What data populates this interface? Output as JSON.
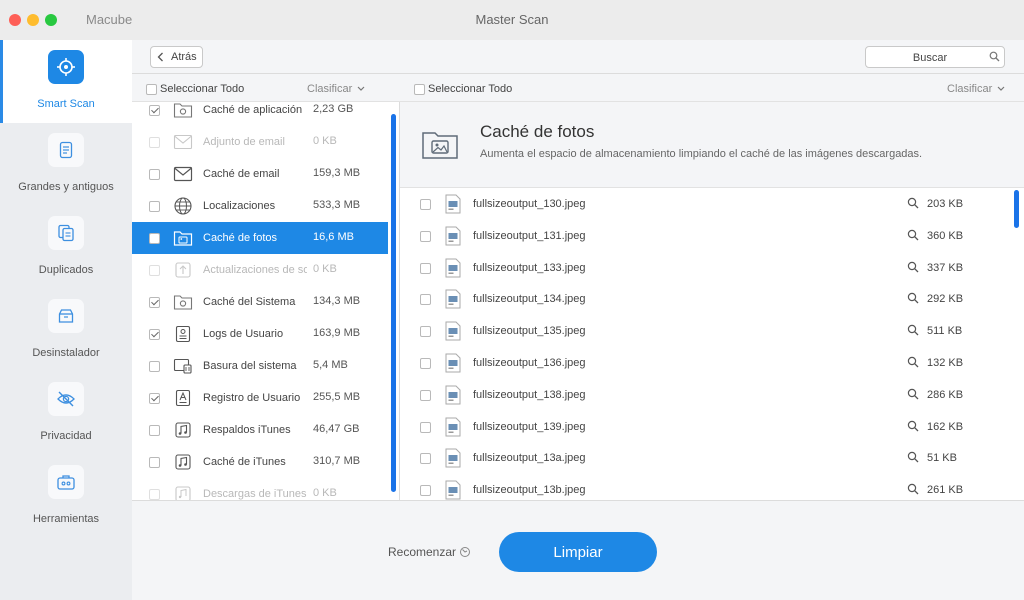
{
  "window": {
    "app_name": "Macube",
    "title": "Master Scan"
  },
  "sidebar": {
    "items": [
      {
        "label": "Smart Scan",
        "icon": "target-icon",
        "active": true
      },
      {
        "label": "Grandes y antiguos",
        "icon": "document-icon",
        "active": false
      },
      {
        "label": "Duplicados",
        "icon": "duplicate-icon",
        "active": false
      },
      {
        "label": "Desinstalador",
        "icon": "box-icon",
        "active": false
      },
      {
        "label": "Privacidad",
        "icon": "eye-off-icon",
        "active": false
      },
      {
        "label": "Herramientas",
        "icon": "toolbox-icon",
        "active": false
      }
    ]
  },
  "toolbar": {
    "back_label": "Atrás",
    "search_placeholder": "Buscar"
  },
  "left_panel": {
    "select_all": "Seleccionar Todo",
    "sort": "Clasificar",
    "categories": [
      {
        "name": "Caché de aplicación",
        "size": "2,23 GB",
        "checked": true,
        "dim": false,
        "icon": "gear-folder-icon"
      },
      {
        "name": "Adjunto de email",
        "size": "0 KB",
        "checked": false,
        "dim": true,
        "icon": "mail-attachment-icon"
      },
      {
        "name": "Caché de email",
        "size": "159,3 MB",
        "checked": false,
        "dim": false,
        "icon": "envelope-icon"
      },
      {
        "name": "Localizaciones",
        "size": "533,3 MB",
        "checked": false,
        "dim": false,
        "icon": "globe-icon"
      },
      {
        "name": "Caché de fotos",
        "size": "16,6 MB",
        "checked": false,
        "dim": false,
        "icon": "photo-folder-icon",
        "selected": true
      },
      {
        "name": "Actualizaciones de so",
        "size": "0 KB",
        "checked": false,
        "dim": true,
        "icon": "update-arrow-icon"
      },
      {
        "name": "Caché del Sistema",
        "size": "134,3 MB",
        "checked": true,
        "dim": false,
        "icon": "gear-folder-icon"
      },
      {
        "name": "Logs de Usuario",
        "size": "163,9 MB",
        "checked": true,
        "dim": false,
        "icon": "user-log-icon"
      },
      {
        "name": "Basura del sistema",
        "size": "5,4 MB",
        "checked": false,
        "dim": false,
        "icon": "system-trash-icon"
      },
      {
        "name": "Registro de Usuario",
        "size": "255,5 MB",
        "checked": true,
        "dim": false,
        "icon": "user-record-icon"
      },
      {
        "name": "Respaldos iTunes",
        "size": "46,47 GB",
        "checked": false,
        "dim": false,
        "icon": "music-note-icon"
      },
      {
        "name": "Caché de iTunes",
        "size": "310,7 MB",
        "checked": false,
        "dim": false,
        "icon": "music-note-icon"
      },
      {
        "name": "Descargas de iTunes",
        "size": "0 KB",
        "checked": false,
        "dim": true,
        "icon": "music-download-icon"
      }
    ]
  },
  "right_panel": {
    "select_all": "Seleccionar Todo",
    "sort": "Clasificar",
    "title": "Caché de fotos",
    "description": "Aumenta el espacio de almacenamiento limpiando el caché de las imágenes descargadas.",
    "files": [
      {
        "name": "fullsizeoutput_130.jpeg",
        "size": "203 KB"
      },
      {
        "name": "fullsizeoutput_131.jpeg",
        "size": "360 KB"
      },
      {
        "name": "fullsizeoutput_133.jpeg",
        "size": "337 KB"
      },
      {
        "name": "fullsizeoutput_134.jpeg",
        "size": "292 KB"
      },
      {
        "name": "fullsizeoutput_135.jpeg",
        "size": "511 KB"
      },
      {
        "name": "fullsizeoutput_136.jpeg",
        "size": "132 KB"
      },
      {
        "name": "fullsizeoutput_138.jpeg",
        "size": "286 KB"
      },
      {
        "name": "fullsizeoutput_139.jpeg",
        "size": "162 KB"
      },
      {
        "name": "fullsizeoutput_13a.jpeg",
        "size": "51 KB"
      },
      {
        "name": "fullsizeoutput_13b.jpeg",
        "size": "261 KB"
      }
    ]
  },
  "footer": {
    "restart_label": "Recomenzar",
    "clean_label": "Limpiar"
  },
  "colors": {
    "accent": "#1e88e5",
    "sidebar_bg": "#ebedf0",
    "panel_bg": "#f4f5f7"
  }
}
